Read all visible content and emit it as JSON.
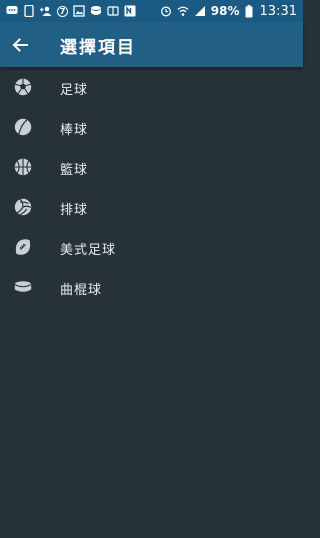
{
  "status_bar": {
    "notification_count": "7",
    "battery": "98%",
    "time": "13:31"
  },
  "toolbar": {
    "title": "選擇項目"
  },
  "sports": [
    {
      "label": "足球",
      "icon": "soccer-ball-icon"
    },
    {
      "label": "棒球",
      "icon": "baseball-icon"
    },
    {
      "label": "籃球",
      "icon": "basketball-icon"
    },
    {
      "label": "排球",
      "icon": "volleyball-icon"
    },
    {
      "label": "美式足球",
      "icon": "american-football-icon"
    },
    {
      "label": "曲棍球",
      "icon": "hockey-puck-icon"
    }
  ],
  "colors": {
    "status_bar": "#1a5a83",
    "toolbar": "#215f84",
    "background": "#263238",
    "icon": "#c9cfd3"
  }
}
